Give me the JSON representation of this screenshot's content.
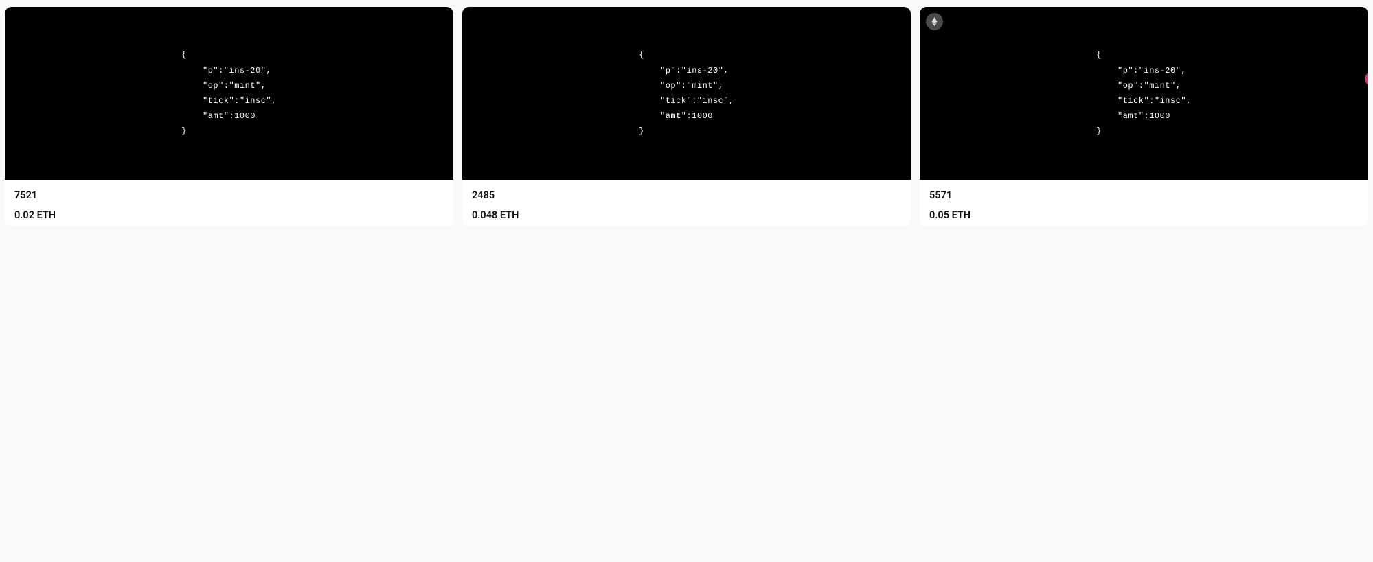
{
  "cards": [
    {
      "id": "7521",
      "price": "0.02 ETH",
      "showBadge": false,
      "inscription": {
        "line1": "{",
        "line2": "    \"p\":\"ins-20\",",
        "line3": "    \"op\":\"mint\",",
        "line4": "    \"tick\":\"insc\",",
        "line5": "    \"amt\":1000",
        "line6": "}"
      }
    },
    {
      "id": "2485",
      "price": "0.048 ETH",
      "showBadge": false,
      "inscription": {
        "line1": "{",
        "line2": "    \"p\":\"ins-20\",",
        "line3": "    \"op\":\"mint\",",
        "line4": "    \"tick\":\"insc\",",
        "line5": "    \"amt\":1000",
        "line6": "}"
      }
    },
    {
      "id": "5571",
      "price": "0.05 ETH",
      "showBadge": true,
      "inscription": {
        "line1": "{",
        "line2": "    \"p\":\"ins-20\",",
        "line3": "    \"op\":\"mint\",",
        "line4": "    \"tick\":\"insc\",",
        "line5": "    \"amt\":1000",
        "line6": "}"
      }
    }
  ]
}
